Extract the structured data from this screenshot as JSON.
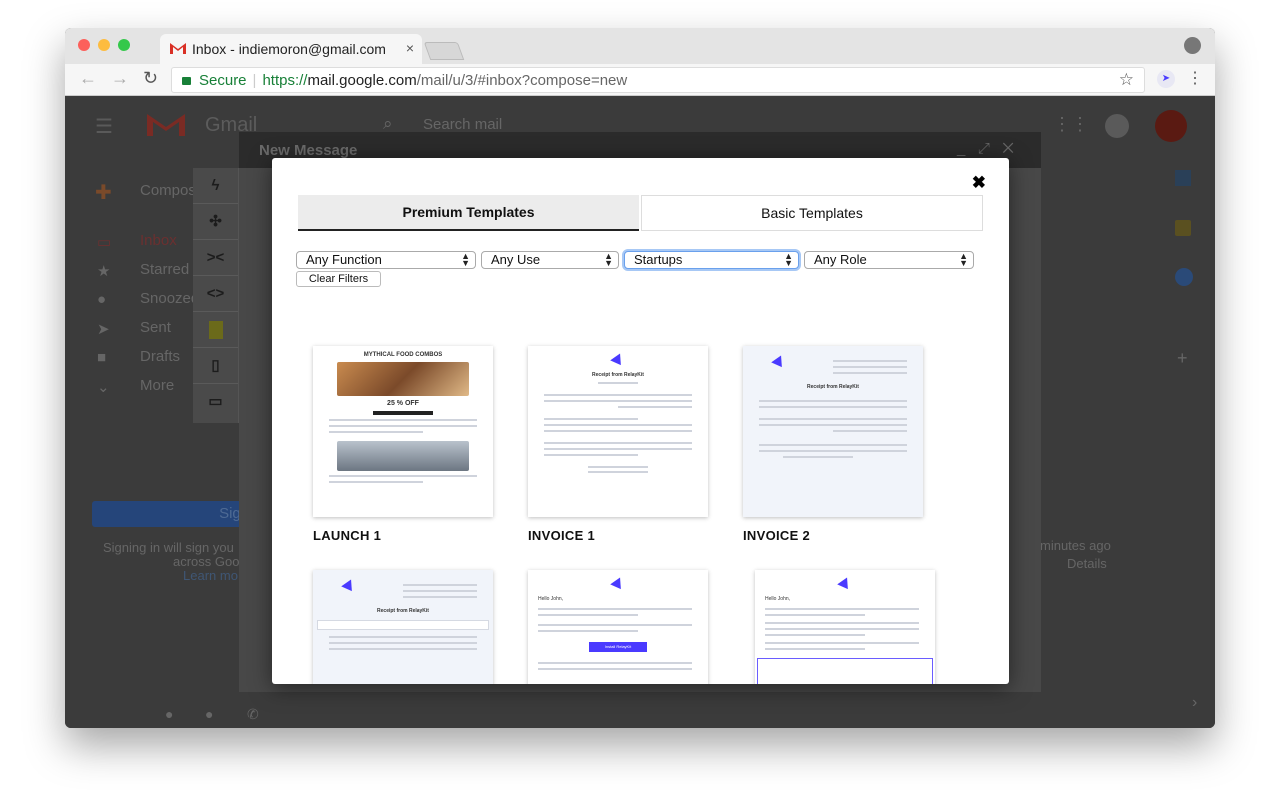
{
  "browser": {
    "tab_title": "Inbox - indiemoron@gmail.com",
    "tab_close": "×",
    "secure_label": "Secure",
    "url_scheme": "https://",
    "url_host": "mail.google.com",
    "url_path": "/mail/u/3/#inbox?compose=new"
  },
  "gmail": {
    "logo_text": "Gmail",
    "search_placeholder": "Search mail",
    "compose_label": "Compose",
    "nav": [
      "Inbox",
      "Starred",
      "Snoozed",
      "Sent",
      "Drafts",
      "More"
    ],
    "signin_button": "Sign in",
    "signin_note1": "Signing in will sign you",
    "signin_note2": "across Goo",
    "learn_more": "Learn mo",
    "activity": "minutes ago",
    "details": "Details",
    "new_message_title": "New Message"
  },
  "toolbar_icons": [
    "bolt-icon",
    "puzzle-icon",
    "collapse-icon",
    "code-icon",
    "document-icon",
    "mobile-icon",
    "desktop-icon"
  ],
  "modal": {
    "close": "✖",
    "tabs": {
      "premium": "Premium Templates",
      "basic": "Basic Templates"
    },
    "filters": {
      "function": "Any Function",
      "use": "Any Use",
      "industry": "Startups",
      "role": "Any Role",
      "clear": "Clear Filters"
    },
    "templates": [
      "LAUNCH 1",
      "INVOICE 1",
      "INVOICE 2"
    ],
    "preview_text": {
      "launch_heading": "MYTHICAL FOOD COMBOS",
      "launch_offer": "25 % OFF",
      "receipt_title": "Receipt from RelayKit",
      "install_button": "Install RelayKit",
      "greeting": "Hello John,"
    }
  }
}
